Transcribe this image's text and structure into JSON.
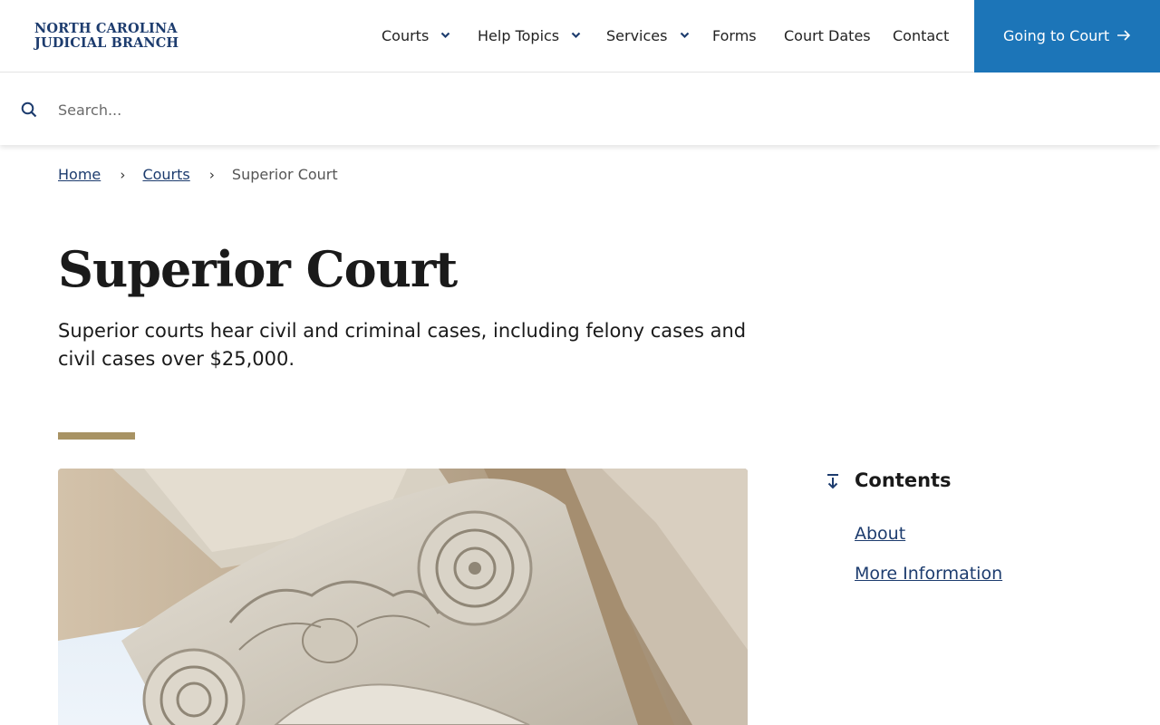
{
  "brand": {
    "logo_line1": "NORTH CAROLINA",
    "logo_line2": "JUDICIAL BRANCH"
  },
  "nav": {
    "items": [
      {
        "label": "Courts",
        "has_dropdown": true
      },
      {
        "label": "Help Topics",
        "has_dropdown": true
      },
      {
        "label": "Services",
        "has_dropdown": true
      },
      {
        "label": "Forms",
        "has_dropdown": false
      },
      {
        "label": "Court Dates",
        "has_dropdown": false
      },
      {
        "label": "Contact",
        "has_dropdown": false
      }
    ],
    "cta_label": "Going to Court"
  },
  "search": {
    "placeholder": "Search...",
    "value": ""
  },
  "breadcrumb": {
    "items": [
      "Home",
      "Courts"
    ],
    "current": "Superior Court"
  },
  "page": {
    "title": "Superior Court",
    "intro": "Superior courts hear civil and criminal cases, including felony cases and civil cases over $25,000."
  },
  "contents": {
    "title": "Contents",
    "links": [
      "About",
      "More Information"
    ]
  },
  "colors": {
    "brand_blue": "#1d3c6e",
    "cta_blue": "#1c75b8",
    "accent_gold": "#a89364"
  },
  "icons": {
    "search": "search-icon",
    "chevron": "chevron-down-icon",
    "arrow": "arrow-right-icon",
    "contents": "arrow-down-to-line-icon"
  }
}
